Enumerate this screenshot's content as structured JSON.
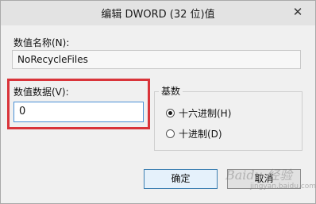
{
  "window": {
    "title": "编辑 DWORD (32 位)值",
    "close_glyph": "✕"
  },
  "value_name": {
    "label": "数值名称(N):",
    "value": "NoRecycleFiles"
  },
  "value_data": {
    "label": "数值数据(V):",
    "value": "0"
  },
  "base": {
    "title": "基数",
    "options": [
      {
        "label": "十六进制(H)",
        "checked": true
      },
      {
        "label": "十进制(D)",
        "checked": false
      }
    ]
  },
  "buttons": {
    "ok_label": "确定",
    "cancel_label": "取消"
  },
  "watermark": {
    "text": "Baidu 经验",
    "sub_text": "jingyan.baidu.com"
  },
  "colors": {
    "highlight": "#d9343a",
    "input_focus_border": "#4a90d6"
  }
}
